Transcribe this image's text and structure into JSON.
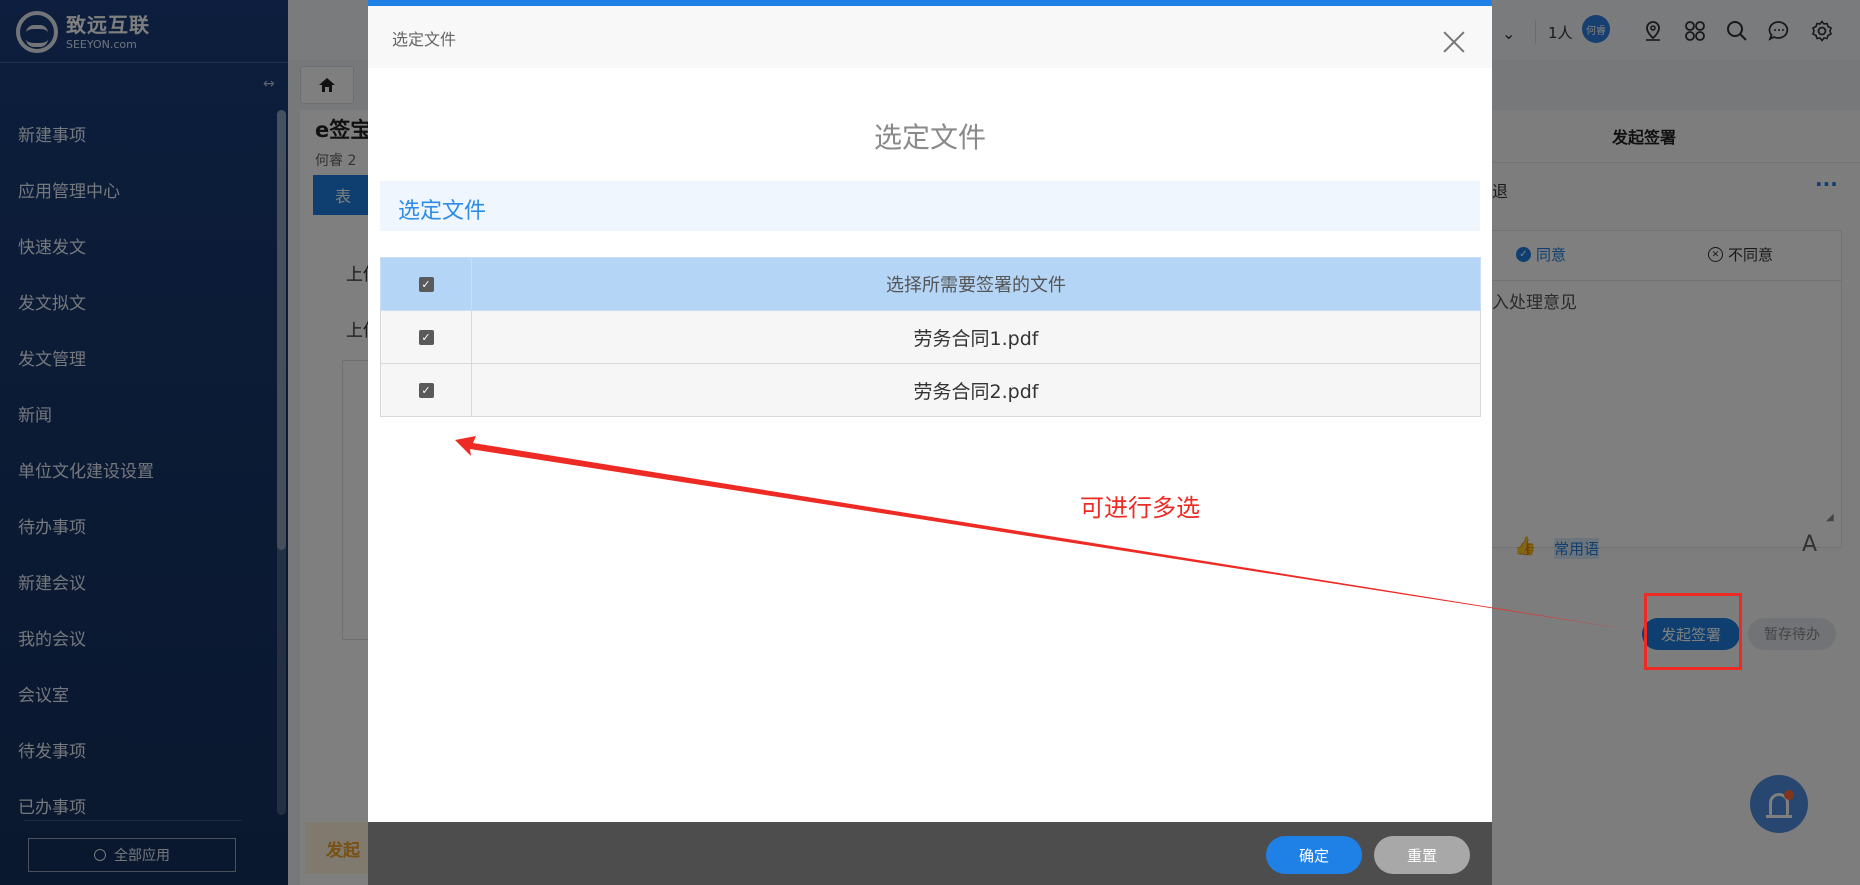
{
  "sidebar": {
    "logo_cn": "致远互联",
    "logo_en": "SEEYON.com",
    "items": [
      {
        "label": "新建事项"
      },
      {
        "label": "应用管理中心"
      },
      {
        "label": "快速发文"
      },
      {
        "label": "发文拟文"
      },
      {
        "label": "发文管理"
      },
      {
        "label": "新闻"
      },
      {
        "label": "单位文化建设设置"
      },
      {
        "label": "待办事项"
      },
      {
        "label": "新建会议"
      },
      {
        "label": "我的会议"
      },
      {
        "label": "会议室"
      },
      {
        "label": "待发事项"
      },
      {
        "label": "已办事项"
      }
    ],
    "all_apps_label": "全部应用"
  },
  "topbar": {
    "people_count": "1人",
    "avatar_text": "何睿",
    "icons": [
      "location-icon",
      "apps-grid-icon",
      "search-icon",
      "chat-icon",
      "settings-icon"
    ]
  },
  "background": {
    "title": "e签宝",
    "subtitle": "何睿   2",
    "tab_label": "表",
    "label1": "上传",
    "label2": "上传",
    "bottom_button": "发起"
  },
  "right_panel": {
    "title": "发起签署",
    "retreat": "退",
    "more": "···",
    "agree": "同意",
    "disagree": "不同意",
    "placeholder": "入处理意见",
    "phrases": "常用语",
    "font_icon": "A",
    "start_sign": "发起签署",
    "save_pending": "暂存待办"
  },
  "dialog": {
    "header_title": "选定文件",
    "main_title": "选定文件",
    "section_title": "选定文件",
    "table": {
      "header": "选择所需要签署的文件",
      "header_checked": true,
      "rows": [
        {
          "name": "劳务合同1.pdf",
          "checked": true
        },
        {
          "name": "劳务合同2.pdf",
          "checked": true
        }
      ]
    },
    "ok_label": "确定",
    "reset_label": "重置"
  },
  "annotation": {
    "text": "可进行多选",
    "color": "#ee2a24"
  },
  "colors": {
    "accent": "#1f80e6",
    "sidebar": "#1a3d7c",
    "table_header": "#b4d5f5"
  }
}
